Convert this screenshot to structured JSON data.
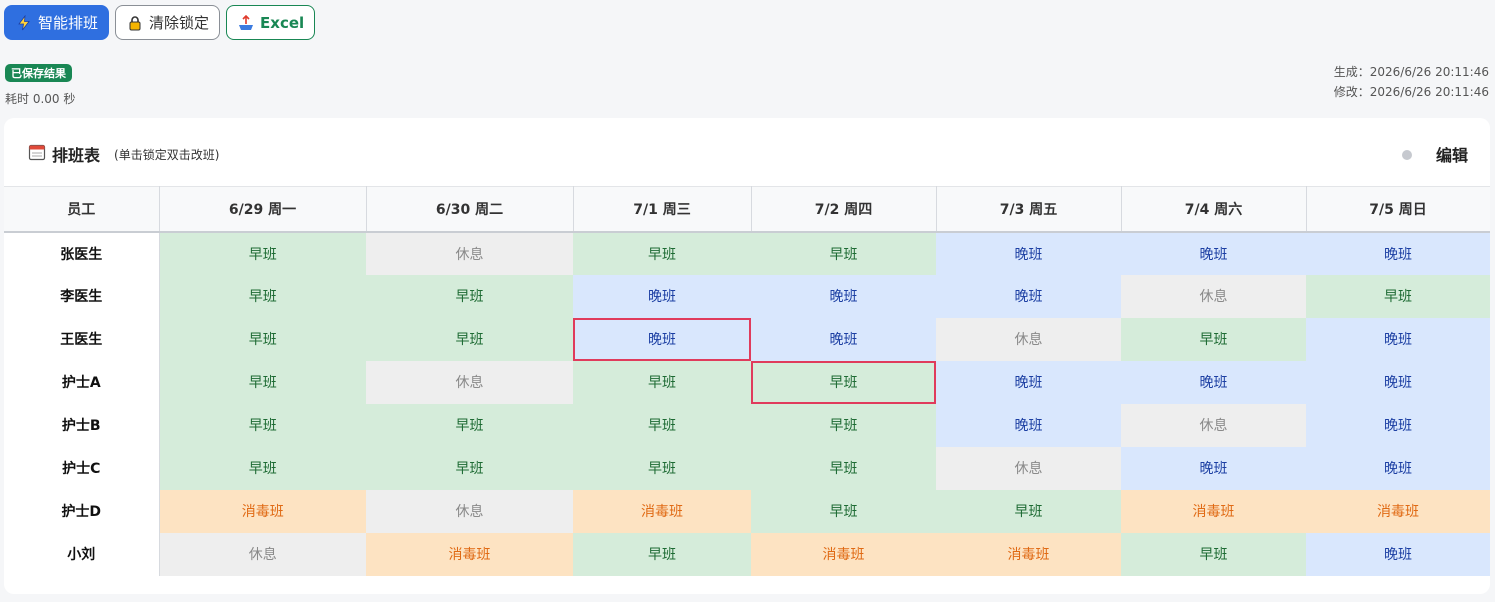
{
  "toolbar": {
    "schedule_label": "智能排班",
    "clear_lock_label": "清除锁定",
    "excel_label": "Excel"
  },
  "status": {
    "saved_badge": "已保存结果",
    "elapsed": "耗时 0.00 秒"
  },
  "meta": {
    "generated": "生成：2026/6/26 20:11:46",
    "modified": "修改：2026/6/26 20:11:46"
  },
  "card": {
    "title": "排班表",
    "hint": "(单击锁定双击改班)",
    "edit_label": "编辑"
  },
  "colors": {
    "primary": "#2f6fe0",
    "success": "#198754",
    "early": "#d5ecda",
    "late": "#d9e7fd",
    "rest": "#eeeeee",
    "disinfect": "#fde3c2",
    "lock_border": "#e03b5c"
  },
  "icons": {
    "schedule": "lightning-icon",
    "clear_lock": "lock-icon",
    "excel": "export-icon",
    "calendar": "calendar-icon"
  },
  "table": {
    "columns": [
      "员工",
      "6/29 周一",
      "6/30 周二",
      "7/1 周三",
      "7/2 周四",
      "7/3 周五",
      "7/4 周六",
      "7/5 周日"
    ],
    "rows": [
      {
        "employee": "张医生",
        "shifts": [
          "早班",
          "休息",
          "早班",
          "早班",
          "晚班",
          "晚班",
          "晚班"
        ],
        "types": [
          "early",
          "rest",
          "early",
          "early",
          "late",
          "late",
          "late"
        ],
        "locked": [
          false,
          false,
          false,
          false,
          false,
          false,
          false
        ]
      },
      {
        "employee": "李医生",
        "shifts": [
          "早班",
          "早班",
          "晚班",
          "晚班",
          "晚班",
          "休息",
          "早班"
        ],
        "types": [
          "early",
          "early",
          "late",
          "late",
          "late",
          "rest",
          "early"
        ],
        "locked": [
          false,
          false,
          false,
          false,
          false,
          false,
          false
        ]
      },
      {
        "employee": "王医生",
        "shifts": [
          "早班",
          "早班",
          "晚班",
          "晚班",
          "休息",
          "早班",
          "晚班"
        ],
        "types": [
          "early",
          "early",
          "late",
          "late",
          "rest",
          "early",
          "late"
        ],
        "locked": [
          false,
          false,
          true,
          false,
          false,
          false,
          false
        ]
      },
      {
        "employee": "护士A",
        "shifts": [
          "早班",
          "休息",
          "早班",
          "早班",
          "晚班",
          "晚班",
          "晚班"
        ],
        "types": [
          "early",
          "rest",
          "early",
          "early",
          "late",
          "late",
          "late"
        ],
        "locked": [
          false,
          false,
          false,
          true,
          false,
          false,
          false
        ]
      },
      {
        "employee": "护士B",
        "shifts": [
          "早班",
          "早班",
          "早班",
          "早班",
          "晚班",
          "休息",
          "晚班"
        ],
        "types": [
          "early",
          "early",
          "early",
          "early",
          "late",
          "rest",
          "late"
        ],
        "locked": [
          false,
          false,
          false,
          false,
          false,
          false,
          false
        ]
      },
      {
        "employee": "护士C",
        "shifts": [
          "早班",
          "早班",
          "早班",
          "早班",
          "休息",
          "晚班",
          "晚班"
        ],
        "types": [
          "early",
          "early",
          "early",
          "early",
          "rest",
          "late",
          "late"
        ],
        "locked": [
          false,
          false,
          false,
          false,
          false,
          false,
          false
        ]
      },
      {
        "employee": "护士D",
        "shifts": [
          "消毒班",
          "休息",
          "消毒班",
          "早班",
          "早班",
          "消毒班",
          "消毒班"
        ],
        "types": [
          "disinfect",
          "rest",
          "disinfect",
          "early",
          "early",
          "disinfect",
          "disinfect"
        ],
        "locked": [
          false,
          false,
          false,
          false,
          false,
          false,
          false
        ]
      },
      {
        "employee": "小刘",
        "shifts": [
          "休息",
          "消毒班",
          "早班",
          "消毒班",
          "消毒班",
          "早班",
          "晚班"
        ],
        "types": [
          "rest",
          "disinfect",
          "early",
          "disinfect",
          "disinfect",
          "early",
          "late"
        ],
        "locked": [
          false,
          false,
          false,
          false,
          false,
          false,
          false
        ]
      }
    ]
  }
}
